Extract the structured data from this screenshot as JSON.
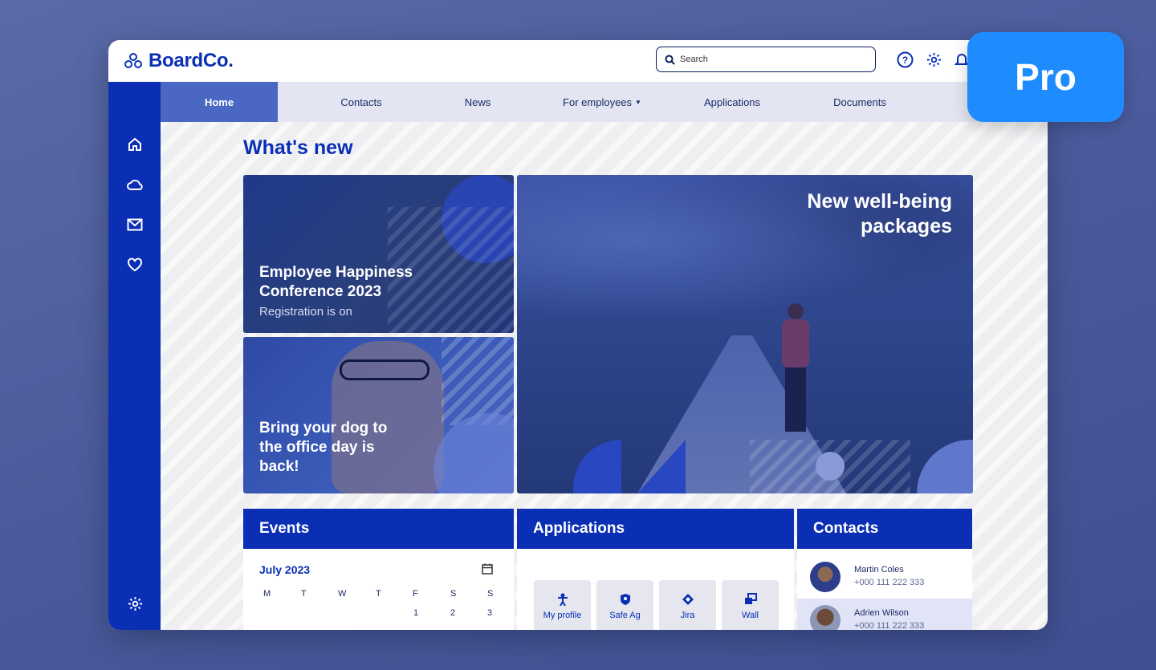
{
  "brand": {
    "name": "BoardCo."
  },
  "search": {
    "placeholder": "Search"
  },
  "nav": {
    "home": "Home",
    "contacts": "Contacts",
    "news": "News",
    "for_employees": "For employees",
    "applications": "Applications",
    "documents": "Documents"
  },
  "main": {
    "section_title": "What's new",
    "cards": {
      "conference": {
        "title": "Employee Happiness Conference 2023",
        "subtitle": "Registration is on"
      },
      "dog": {
        "title": "Bring your dog to the office day is back!"
      },
      "wellbeing": {
        "title": "New well-being packages"
      }
    }
  },
  "events": {
    "title": "Events",
    "month": "July 2023",
    "weekdays": [
      "M",
      "T",
      "W",
      "T",
      "F",
      "S",
      "S"
    ],
    "first_row": [
      "",
      "",
      "",
      "",
      "1",
      "2",
      "3"
    ]
  },
  "applications": {
    "title": "Applications",
    "tiles": [
      {
        "label": "My profile",
        "icon": "person-icon"
      },
      {
        "label": "Safe Ag",
        "icon": "shield-icon"
      },
      {
        "label": "Jira",
        "icon": "diamond-icon"
      },
      {
        "label": "Wall",
        "icon": "copy-icon"
      }
    ]
  },
  "contacts": {
    "title": "Contacts",
    "people": [
      {
        "name": "Martin Coles",
        "phone": "+000 111 222 333"
      },
      {
        "name": "Adrien Wilson",
        "phone": "+000 111 222 333"
      }
    ]
  },
  "badge": {
    "label": "Pro"
  },
  "colors": {
    "brand_blue": "#0a2fb5",
    "pro_badge": "#1e8cff",
    "active_nav": "#4a67c4"
  }
}
